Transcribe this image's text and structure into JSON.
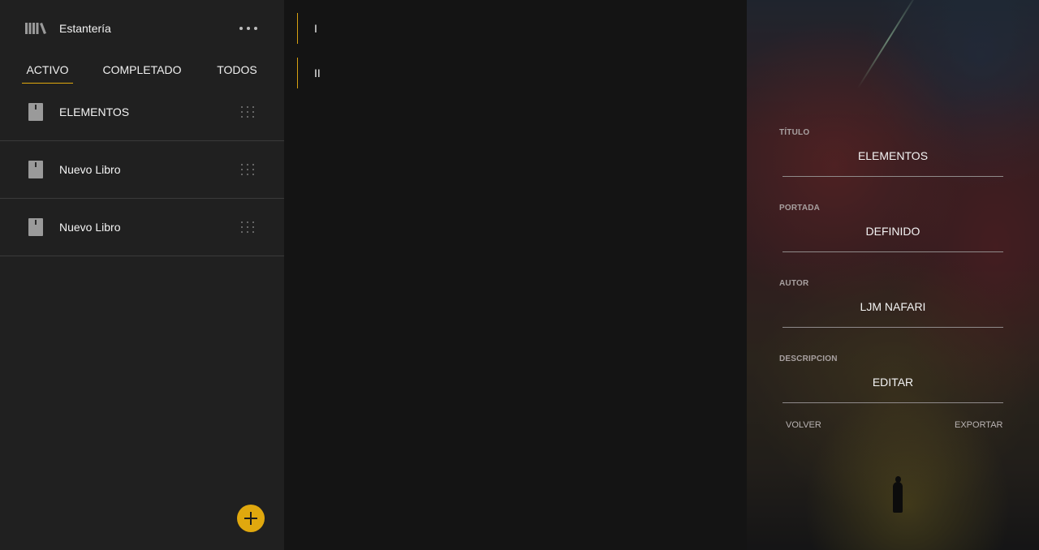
{
  "sidebar": {
    "title": "Estantería",
    "icons": {
      "shelf": "bookshelf-icon",
      "more": "more-horizontal-icon",
      "book": "book-icon",
      "drag": "drag-handle-icon",
      "add": "plus-icon"
    },
    "tabs": [
      {
        "label": "ACTIVO",
        "active": true
      },
      {
        "label": "COMPLETADO",
        "active": false
      },
      {
        "label": "TODOS",
        "active": false
      }
    ],
    "books": [
      {
        "label": "ELEMENTOS"
      },
      {
        "label": "Nuevo Libro"
      },
      {
        "label": "Nuevo Libro"
      }
    ]
  },
  "chapters": [
    {
      "label": "I"
    },
    {
      "label": "II"
    }
  ],
  "details": {
    "fields": [
      {
        "label": "TÍTULO",
        "value": "ELEMENTOS"
      },
      {
        "label": "PORTADA",
        "value": "DEFINIDO"
      },
      {
        "label": "AUTOR",
        "value": "LJM NAFARI"
      },
      {
        "label": "DESCRIPCION",
        "value": "EDITAR"
      }
    ],
    "back_label": "VOLVER",
    "export_label": "EXPORTAR"
  },
  "colors": {
    "accent": "#e0a80e",
    "sidebar_bg": "#202020",
    "main_bg": "#141414"
  }
}
